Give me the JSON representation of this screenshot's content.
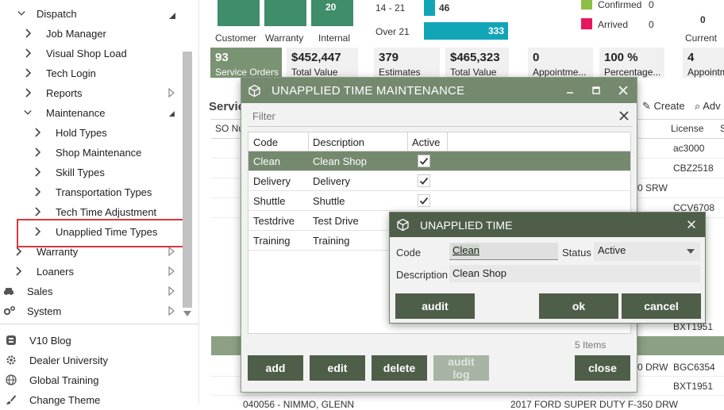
{
  "sidebar": {
    "items": [
      {
        "label": "Dispatch"
      },
      {
        "label": "Job Manager"
      },
      {
        "label": "Visual Shop Load"
      },
      {
        "label": "Tech Login"
      },
      {
        "label": "Reports"
      },
      {
        "label": "Maintenance"
      },
      {
        "label": "Hold Types"
      },
      {
        "label": "Shop Maintenance"
      },
      {
        "label": "Skill Types"
      },
      {
        "label": "Transportation Types"
      },
      {
        "label": "Tech Time Adjustment"
      },
      {
        "label": "Unapplied Time Types"
      },
      {
        "label": "Warranty"
      },
      {
        "label": "Loaners"
      },
      {
        "label": "Sales"
      },
      {
        "label": "System"
      },
      {
        "label": "V10 Blog"
      },
      {
        "label": "Dealer University"
      },
      {
        "label": "Global Training"
      },
      {
        "label": "Change Theme"
      }
    ]
  },
  "dashboard": {
    "bar_labels": [
      "Customer",
      "Warranty",
      "Internal"
    ],
    "internal_value": "20",
    "aging": [
      {
        "range": "14 - 21",
        "count": "46"
      },
      {
        "range": "Over 21",
        "count": "333"
      }
    ],
    "legend": [
      {
        "label": "Confirmed",
        "count": "0",
        "color": "#8cbf45"
      },
      {
        "label": "Arrived",
        "count": "0",
        "color": "#e8175d"
      }
    ],
    "current_label": "Current",
    "current_value": "0",
    "tiles": [
      {
        "value": "93",
        "label": "Service Orders"
      },
      {
        "value": "$452,447",
        "label": "Total Value"
      },
      {
        "value": "379",
        "label": "Estimates"
      },
      {
        "value": "$465,323",
        "label": "Total Value"
      },
      {
        "value": "0",
        "label": "Appointme..."
      },
      {
        "value": "100 %",
        "label": "Percentage..."
      },
      {
        "value": "4",
        "label": "Appointm"
      }
    ],
    "section_title": "Servic",
    "create_label": "Create",
    "adv_label": "Adv",
    "col_so": "SO Nu",
    "col_license": "License",
    "col_s": "S",
    "licenses": [
      "ac3000",
      "CBZ2518",
      "",
      "CCV6708",
      "",
      "",
      "",
      "",
      "",
      "BXT1951",
      "",
      "BGC6354",
      "BXT1951"
    ],
    "vehicle_fragments": [
      "0 SRW",
      "0 DRW"
    ],
    "bottom_row": "040056 - NIMMO, GLENN",
    "bottom_vehicle": "2017 FORD SUPER DUTY F-350 DRW"
  },
  "dialog1": {
    "title": "UNAPPLIED TIME MAINTENANCE",
    "filter_placeholder": "Filter",
    "columns": [
      "Code",
      "Description",
      "Active"
    ],
    "rows": [
      {
        "code": "Clean",
        "description": "Clean Shop",
        "active": true
      },
      {
        "code": "Delivery",
        "description": "Delivery",
        "active": true
      },
      {
        "code": "Shuttle",
        "description": "Shuttle",
        "active": true
      },
      {
        "code": "Testdrive",
        "description": "Test Drive",
        "active": true
      },
      {
        "code": "Training",
        "description": "Training",
        "active": true
      }
    ],
    "items_count": "5 Items",
    "buttons": {
      "add": "add",
      "edit": "edit",
      "delete": "delete",
      "audit_log": "audit log",
      "close": "close"
    }
  },
  "dialog2": {
    "title": "UNAPPLIED TIME",
    "code_label": "Code",
    "code_value": "Clean",
    "status_label": "Status",
    "status_value": "Active",
    "description_label": "Description",
    "description_value": "Clean Shop",
    "buttons": {
      "audit": "audit",
      "ok": "ok",
      "cancel": "cancel"
    }
  },
  "colors": {
    "title_green": "#75896f",
    "dark_green": "#4e5e49",
    "highlight_red": "#d9363e",
    "teal": "#12a5b8",
    "bar_green": "#3f8d6a"
  }
}
